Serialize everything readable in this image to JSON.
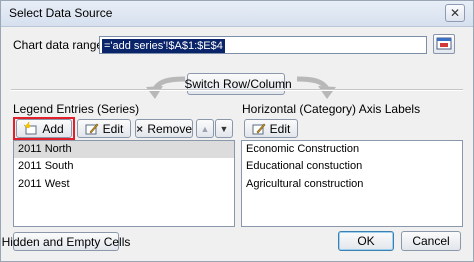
{
  "dialog": {
    "title": "Select Data Source",
    "close_glyph": "✕"
  },
  "range": {
    "label": "Chart data range:",
    "value": "='add series'!$A$1:$E$4"
  },
  "switch_button": {
    "label": "Switch Row/Column"
  },
  "legend": {
    "heading": "Legend Entries (Series)",
    "add_label": "Add",
    "edit_label": "Edit",
    "remove_label": "Remove",
    "up_glyph": "▲",
    "down_glyph": "▼",
    "items": [
      "2011 North",
      "2011 South",
      "2011 West"
    ]
  },
  "axis": {
    "heading": "Horizontal (Category) Axis Labels",
    "edit_label": "Edit",
    "items": [
      "Economic Construction",
      "Educational constuction",
      "Agricultural construction"
    ]
  },
  "footer": {
    "hidden_cells_label": "Hidden and Empty Cells",
    "ok_label": "OK",
    "cancel_label": "Cancel"
  },
  "colors": {
    "highlight_border": "#e0202b",
    "selected_row": "#dcdcdc",
    "range_selection": "#0a246a"
  }
}
